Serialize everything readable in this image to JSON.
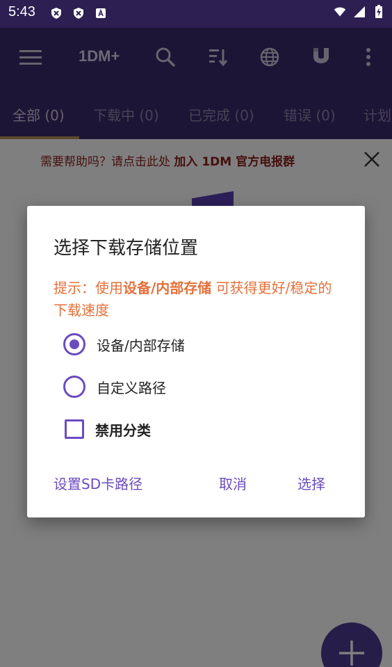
{
  "status_bar": {
    "time": "5:43",
    "icons": [
      "shield-x-icon",
      "shield-x-icon",
      "text-a-icon",
      "wifi-icon",
      "signal-icon",
      "battery-charging-icon"
    ]
  },
  "app_bar": {
    "title": "1DM+",
    "icons": [
      "menu-icon",
      "search-icon",
      "sort-icon",
      "globe-icon",
      "magnet-icon",
      "more-vert-icon"
    ]
  },
  "tabs": [
    {
      "label": "全部 (0)",
      "active": true
    },
    {
      "label": "下载中 (0)",
      "active": false
    },
    {
      "label": "已完成 (0)",
      "active": false
    },
    {
      "label": "错误 (0)",
      "active": false
    },
    {
      "label": "计划",
      "active": false
    }
  ],
  "help_banner": {
    "text_prefix": "需要帮助吗？请点击此处 ",
    "text_bold": "加入 1DM 官方电报群"
  },
  "dialog": {
    "title": "选择下载存储位置",
    "tip_prefix": "提示：使用",
    "tip_bold": "设备/内部存储",
    "tip_suffix": " 可获得更好/稳定的下载速度",
    "options": [
      {
        "label": "设备/内部存储",
        "type": "radio",
        "checked": true
      },
      {
        "label": "自定义路径",
        "type": "radio",
        "checked": false
      },
      {
        "label": "禁用分类",
        "type": "checkbox",
        "checked": false
      }
    ],
    "actions": {
      "sd_card": "设置SD卡路径",
      "cancel": "取消",
      "select": "选择"
    }
  },
  "colors": {
    "app_bar": "#3a2a6b",
    "accent": "#6b4bc0",
    "tip": "#e4703a",
    "help": "#8d1f1f",
    "tab_indicator": "#b7905a"
  }
}
